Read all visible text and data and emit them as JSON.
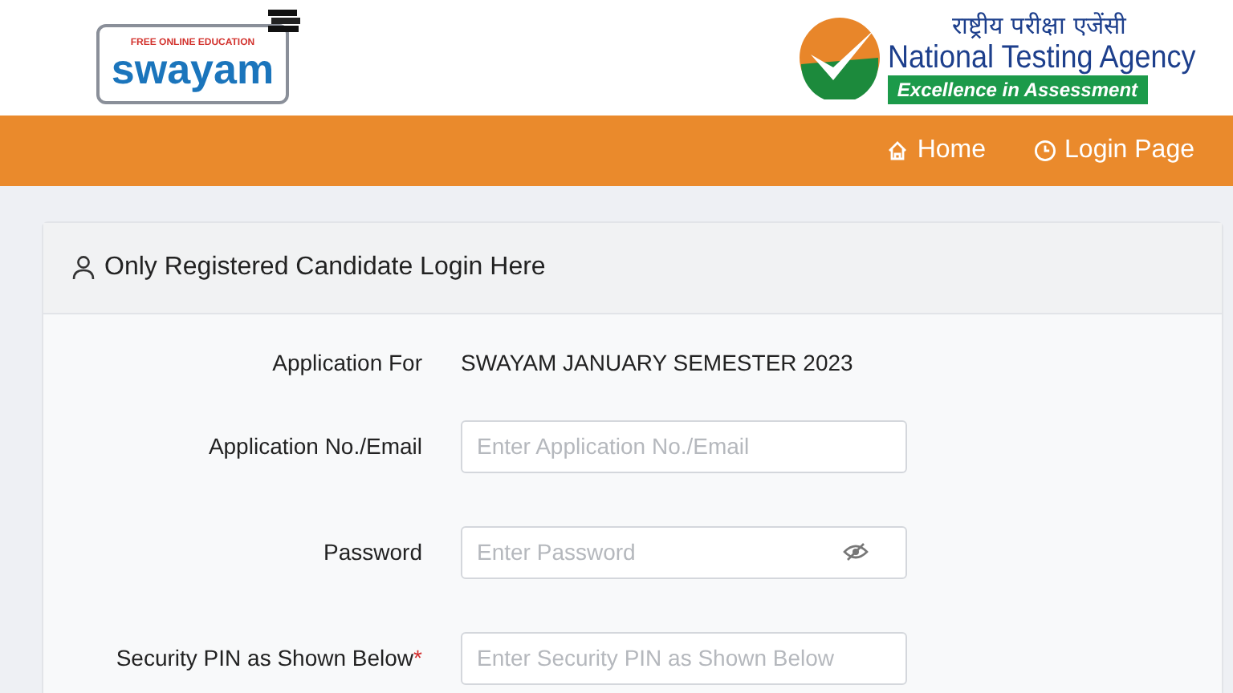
{
  "header": {
    "swayam_logo": {
      "tagline": "FREE ONLINE EDUCATION",
      "name": "swayam"
    },
    "nta_logo": {
      "hindi": "राष्ट्रीय परीक्षा एजेंसी",
      "name": "National Testing Agency",
      "motto": "Excellence in Assessment"
    }
  },
  "nav": [
    {
      "label": "Home"
    },
    {
      "label": "Login Page"
    }
  ],
  "card": {
    "title": "Only Registered Candidate Login Here",
    "rows": [
      {
        "kind": "text",
        "label": "Application For",
        "value": "SWAYAM JANUARY SEMESTER 2023"
      },
      {
        "kind": "input",
        "label": "Application No./Email",
        "placeholder": "Enter Application No./Email"
      },
      {
        "kind": "password",
        "label": "Password",
        "placeholder": "Enter Password"
      },
      {
        "kind": "input",
        "label": "Security PIN as Shown Below",
        "required_mark": "*",
        "placeholder": "Enter Security PIN as Shown Below"
      }
    ]
  }
}
